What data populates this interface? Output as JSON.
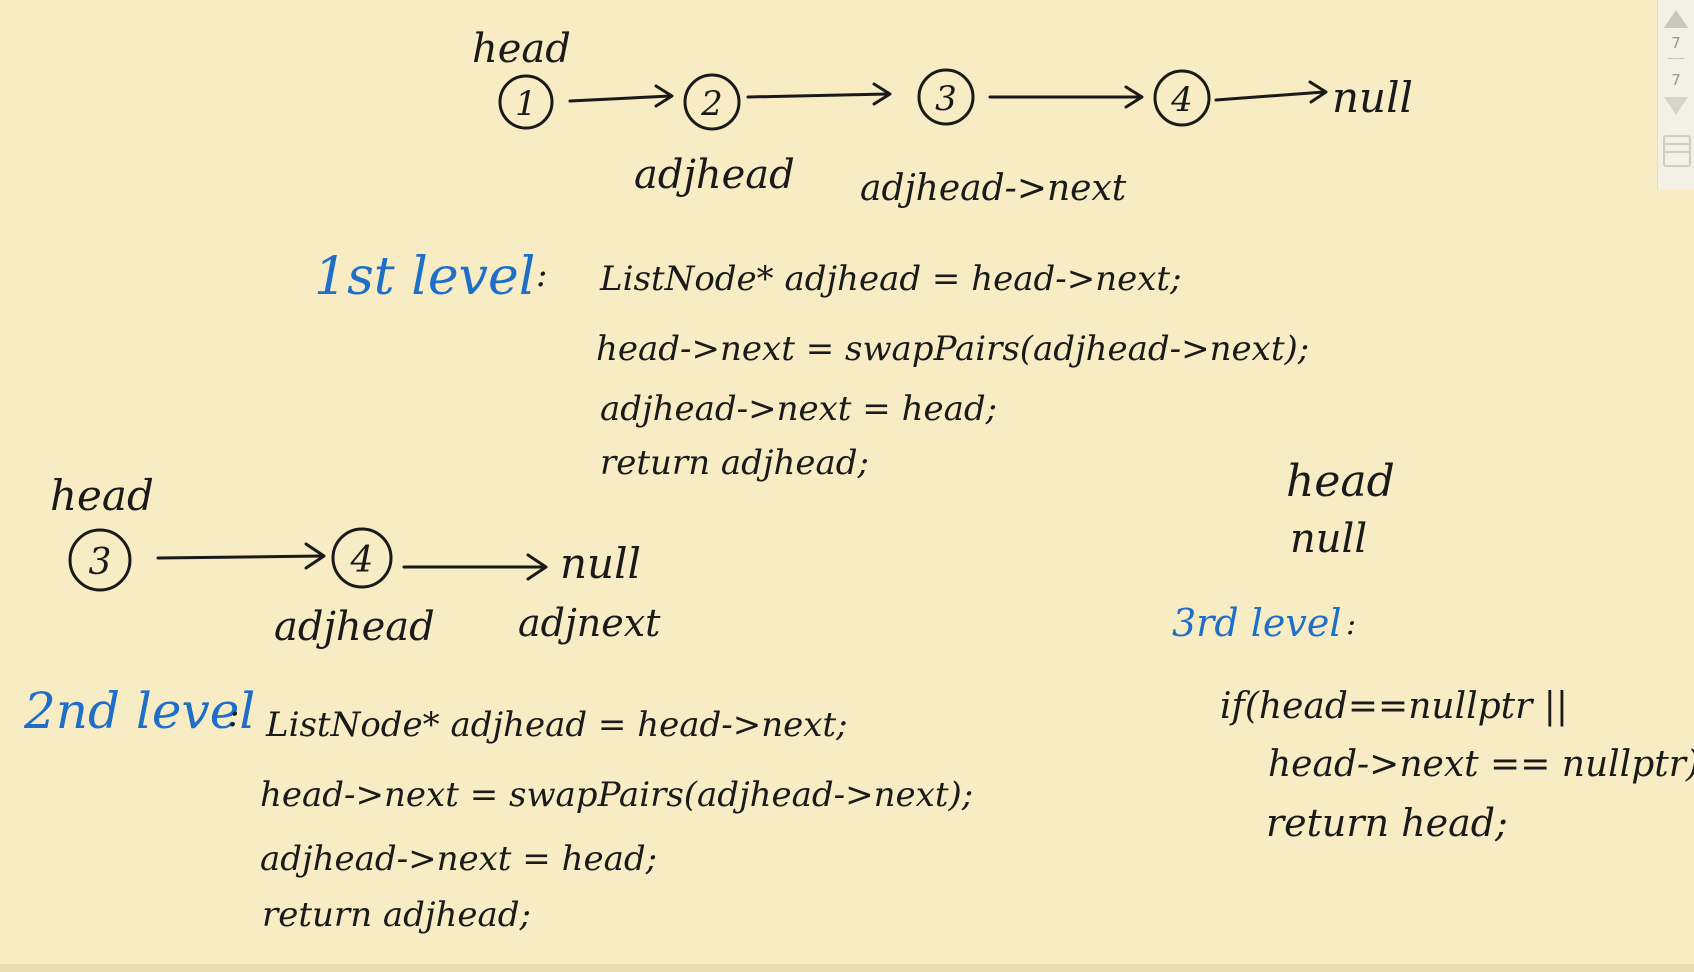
{
  "top_chain": {
    "head_label": "head",
    "nodes": [
      "1",
      "2",
      "3",
      "4"
    ],
    "tail": "null",
    "under_labels": [
      "adjhead",
      "adjhead->next"
    ]
  },
  "level1": {
    "title": "1st level",
    "colon": ":",
    "lines": [
      "ListNode*  adjhead = head->next;",
      "head->next = swapPairs(adjhead->next);",
      "adjhead->next = head;",
      "return adjhead;"
    ]
  },
  "second_chain": {
    "head_label": "head",
    "nodes": [
      "3",
      "4"
    ],
    "tail": "null",
    "under_labels": [
      "adjhead",
      "adjnext"
    ]
  },
  "level2": {
    "title": "2nd level",
    "colon": ":",
    "lines": [
      "ListNode*  adjhead = head->next;",
      "head->next = swapPairs(adjhead->next);",
      "adjhead->next = head;",
      "return adjhead;"
    ]
  },
  "third_chain": {
    "head_label": "head",
    "node": "null"
  },
  "level3": {
    "title": "3rd level",
    "colon": ":",
    "lines": [
      "if(head==nullptr ||",
      "head->next == nullptr)",
      "return head;"
    ]
  },
  "toolbar": {
    "page_current": "7",
    "page_total": "7",
    "icons": [
      "scroll-up-icon",
      "scroll-down-icon",
      "layers-icon"
    ]
  },
  "colors": {
    "paper": "#f7ecc4",
    "ink": "#1a1a1a",
    "blue_ink": "#1f6fc9"
  }
}
